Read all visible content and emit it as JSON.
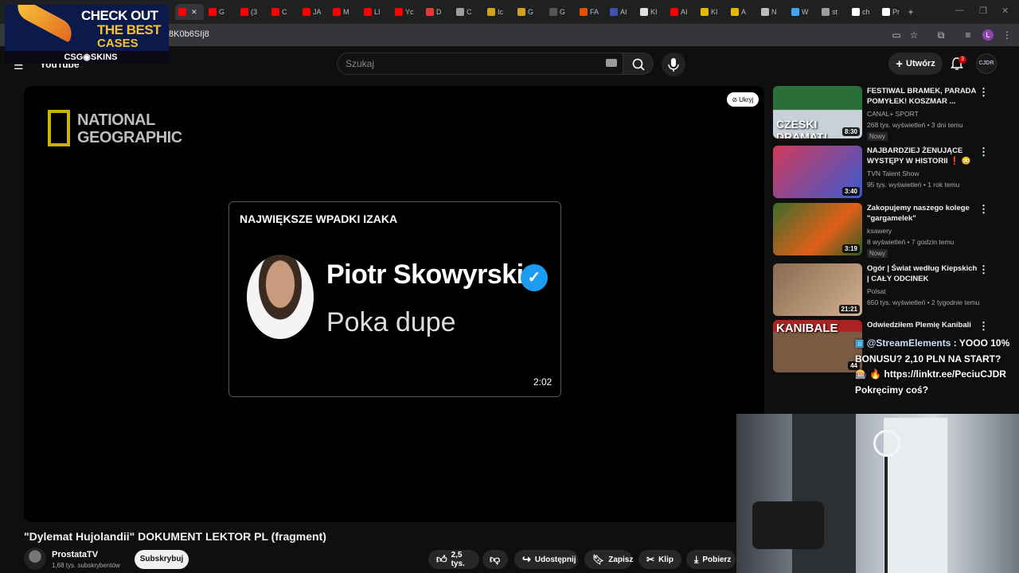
{
  "browser": {
    "url_fragment": "8K0b6SIj8",
    "tabs": [
      {
        "label": "",
        "color": "#ff0000"
      },
      {
        "label": "G",
        "color": "#ff0000"
      },
      {
        "label": "(3",
        "color": "#ff0000"
      },
      {
        "label": "C",
        "color": "#ff0000"
      },
      {
        "label": "JA",
        "color": "#ff0000"
      },
      {
        "label": "M",
        "color": "#ff0000"
      },
      {
        "label": "LI",
        "color": "#ff0000"
      },
      {
        "label": "Yc",
        "color": "#ff0000"
      },
      {
        "label": "D",
        "color": "#e53935"
      },
      {
        "label": "C",
        "color": "#9e9e9e"
      },
      {
        "label": "Ic",
        "color": "#d4a017"
      },
      {
        "label": "G",
        "color": "#d4a017"
      },
      {
        "label": "G",
        "color": "#555555"
      },
      {
        "label": "FA",
        "color": "#e65100"
      },
      {
        "label": "AI",
        "color": "#3f51b5"
      },
      {
        "label": "KI",
        "color": "#e0e0e0"
      },
      {
        "label": "AI",
        "color": "#ff0000"
      },
      {
        "label": "KI",
        "color": "#e6b800"
      },
      {
        "label": "A",
        "color": "#e6b800"
      },
      {
        "label": "N",
        "color": "#bdbdbd"
      },
      {
        "label": "W",
        "color": "#42a5f5"
      },
      {
        "label": "st",
        "color": "#9e9e9e"
      },
      {
        "label": "ch",
        "color": "#ffffff"
      },
      {
        "label": "Pr",
        "color": "#ffffff"
      }
    ],
    "new_tab_icon": "plus-icon",
    "profile_initial": "L"
  },
  "ad": {
    "line1": "CHECK OUT",
    "line2": "THE BEST",
    "line3": "CASES",
    "brand": "CSG◉SKINS"
  },
  "youtube": {
    "logo": "YouTube",
    "search_placeholder": "Szukaj",
    "create_label": "Utwórz",
    "notifications_count": "3",
    "avatar_text": "CJDR"
  },
  "player": {
    "watermark": [
      "NATIONAL",
      "GEOGRAPHIC"
    ],
    "hide_label": "Ukryj",
    "card_title": "NAJWIĘKSZE WPADKI IZAKA",
    "card_name": "Piotr Skowyrski",
    "card_text": "Poka dupe",
    "card_time": "2:02"
  },
  "video": {
    "title": "\"Dylemat Hujolandii\" DOKUMENT LEKTOR PL (fragment)",
    "channel": "ProstataTV",
    "subscribers": "1,68 tys. subskrybentów",
    "subscribe_label": "Subskrybuj",
    "likes": "2,5 tys.",
    "share_label": "Udostępnij",
    "save_label": "Zapisz",
    "clip_label": "Klip",
    "download_label": "Pobierz"
  },
  "recommendations": [
    {
      "title": "FESTIWAL BRAMEK, PARADA POMYŁEK! KOSZMAR ...",
      "channel": "CANAL+ SPORT",
      "meta": "268 tys. wyświetleń • 3 dni temu",
      "badge": "Nowy",
      "duration": "8:30",
      "thumb_text": "CZESKI DRAMAT!"
    },
    {
      "title": "NAJBARDZIEJ ŻENUJĄCE WYSTĘPY W HISTORII ❗ 😳 I...",
      "channel": "TVN Talent Show",
      "meta": "95 tys. wyświetleń • 1 rok temu",
      "badge": "",
      "duration": "3:40",
      "thumb_text": ""
    },
    {
      "title": "Zakopujemy naszego kolege \"gargamelek\"",
      "channel": "ksawery",
      "meta": "8 wyświetleń • 7 godzin temu",
      "badge": "Nowy",
      "duration": "3:19",
      "thumb_text": ""
    },
    {
      "title": "Ogór | Świat według Kiepskich | CAŁY ODCINEK",
      "channel": "Polsat",
      "meta": "650 tys. wyświetleń • 2 tygodnie temu",
      "badge": "",
      "duration": "21:21",
      "thumb_text": ""
    },
    {
      "title": "Odwiedziłem Plemię Kanibali",
      "channel": "",
      "meta": "",
      "badge": "",
      "duration": "44",
      "thumb_text": "KANIBALE"
    }
  ],
  "chat": {
    "user": "@StreamElements",
    "message": ": YOOO 10% BONUSU? 2,10 PLN NA START? 🎰 🔥 https://linktr.ee/PeciuCJDR Pokręcimy coś?"
  },
  "colors": {
    "youtube_red": "#ff0000",
    "background": "#0f0f0f",
    "ng_yellow": "#c9b200",
    "verified_blue": "#1d9bf0"
  }
}
